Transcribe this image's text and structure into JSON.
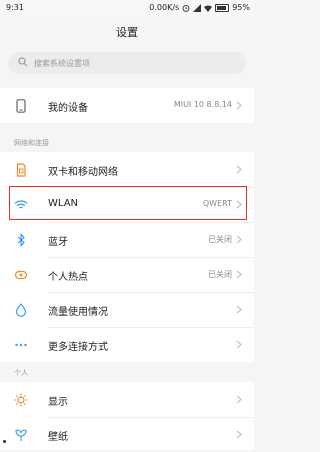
{
  "status_bar": {
    "time": "9:31",
    "speed": "0.00K/s",
    "battery": "95%"
  },
  "header": {
    "title": "设置"
  },
  "search": {
    "placeholder": "搜索系统设置项"
  },
  "device": {
    "label": "我的设备",
    "value": "MIUI 10 8.8.14"
  },
  "network": {
    "section_label": "网络和连接",
    "items": [
      {
        "label": "双卡和移动网络",
        "value": "",
        "icon": "sim-card-icon"
      },
      {
        "label": "WLAN",
        "value": "QWERT",
        "icon": "wifi-icon"
      },
      {
        "label": "蓝牙",
        "value": "已关闭",
        "icon": "bluetooth-icon"
      },
      {
        "label": "个人热点",
        "value": "已关闭",
        "icon": "hotspot-icon"
      },
      {
        "label": "流量使用情况",
        "value": "",
        "icon": "data-usage-icon"
      },
      {
        "label": "更多连接方式",
        "value": "",
        "icon": "more-connections-icon"
      }
    ]
  },
  "personal": {
    "section_label": "个人",
    "items": [
      {
        "label": "显示",
        "value": "",
        "icon": "display-icon"
      },
      {
        "label": "壁纸",
        "value": "",
        "icon": "wallpaper-icon"
      }
    ]
  },
  "colors": {
    "highlight": "#e0322b",
    "wifi": "#3aa0e8",
    "orange": "#f08a24",
    "blue": "#3d8fe6"
  }
}
